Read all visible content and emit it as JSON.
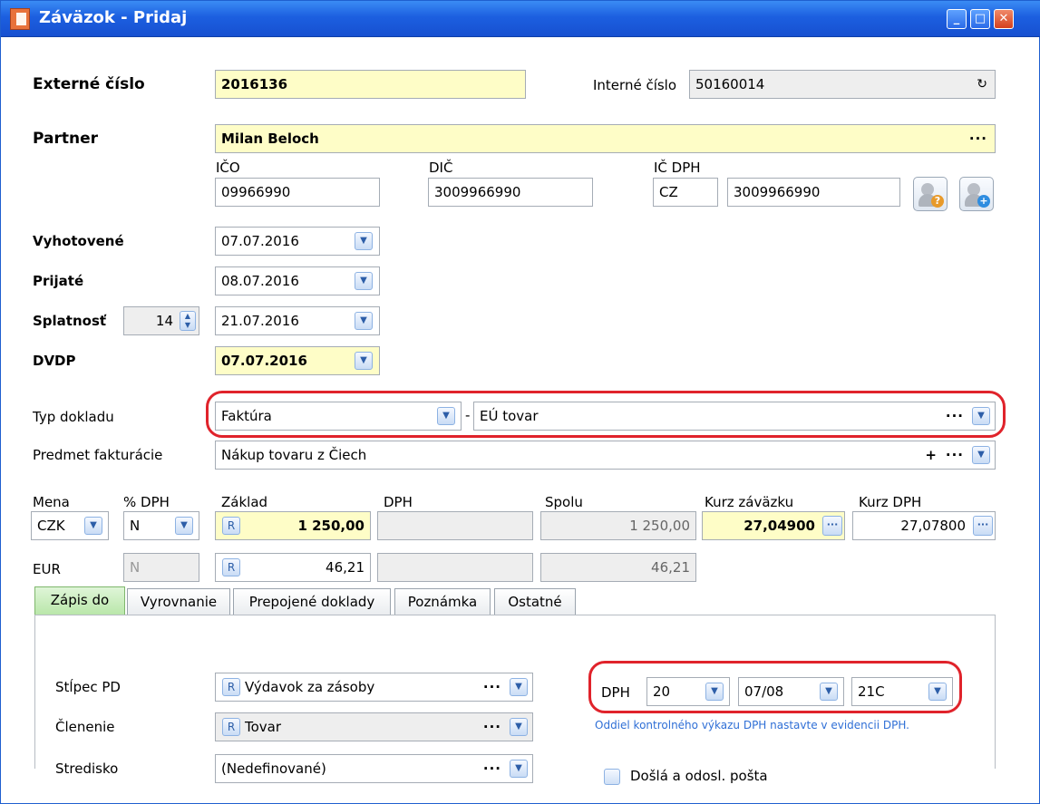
{
  "window": {
    "title": "Záväzok - Pridaj",
    "minimize": "_",
    "maximize": "□",
    "close": "✕"
  },
  "form": {
    "externe_cislo_label": "Externé číslo",
    "externe_cislo_value": "2016136",
    "interne_cislo_label": "Interné číslo",
    "interne_cislo_value": "50160014",
    "partner_label": "Partner",
    "partner_value": "Milan Beloch",
    "ico_label": "IČO",
    "ico_value": "09966990",
    "dic_label": "DIČ",
    "dic_value": "3009966990",
    "icdph_label": "IČ DPH",
    "icdph_prefix": "CZ",
    "icdph_value": "3009966990",
    "vyhotovene_label": "Vyhotovené",
    "vyhotovene_value": "07.07.2016",
    "prijate_label": "Prijaté",
    "prijate_value": "08.07.2016",
    "splatnost_label": "Splatnosť",
    "splatnost_days": "14",
    "splatnost_value": "21.07.2016",
    "dvdp_label": "DVDP",
    "dvdp_value": "07.07.2016",
    "typ_dokladu_label": "Typ dokladu",
    "typ_dokladu_value": "Faktúra",
    "typ_separator": "-",
    "typ_sub_value": "EÚ tovar",
    "predmet_label": "Predmet fakturácie",
    "predmet_value": "Nákup tovaru z Čiech"
  },
  "amounts": {
    "mena_label": "Mena",
    "dph_pct_label": "% DPH",
    "zaklad_label": "Základ",
    "dph_label": "DPH",
    "spolu_label": "Spolu",
    "kurz_zavazku_label": "Kurz záväzku",
    "kurz_dph_label": "Kurz DPH",
    "mena_value": "CZK",
    "dph_pct_value": "N",
    "zaklad_value": "1 250,00",
    "spolu_value": "1 250,00",
    "kurz_zavazku_value": "27,04900",
    "kurz_dph_value": "27,07800",
    "eur_label": "EUR",
    "eur_dph_pct": "N",
    "eur_zaklad": "46,21",
    "eur_spolu": "46,21",
    "r_label": "R"
  },
  "tabs": [
    {
      "label": "Zápis do"
    },
    {
      "label": "Vyrovnanie"
    },
    {
      "label": "Prepojené doklady"
    },
    {
      "label": "Poznámka"
    },
    {
      "label": "Ostatné"
    }
  ],
  "zapis": {
    "stlpec_label": "Stĺpec PD",
    "stlpec_value": "Výdavok za zásoby",
    "clenenie_label": "Členenie",
    "clenenie_value": "Tovar",
    "stredisko_label": "Stredisko",
    "stredisko_value": "(Nedefinované)",
    "dph_label": "DPH",
    "dph_rate": "20",
    "dph_period": "07/08",
    "dph_code": "21C",
    "note": "Oddiel kontrolného výkazu DPH nastavte v evidencii DPH.",
    "posta_label": "Došlá a odosl. pošta"
  },
  "symbols": {
    "dots": "···",
    "plus": "+",
    "down": "▼",
    "refresh": "↻",
    "q": "?",
    "add": "+"
  },
  "colors": {
    "titlebar": "#1c5fe0",
    "required_field": "#fefdc7",
    "highlight_oval": "#e0232b",
    "active_tab": "#b8e6a8"
  }
}
